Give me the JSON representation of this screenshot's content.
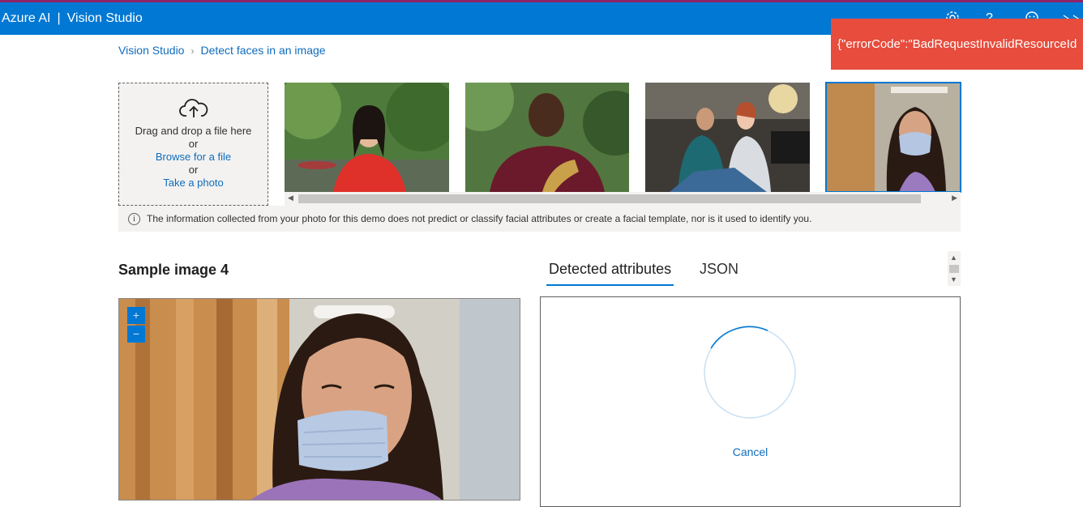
{
  "header": {
    "brand": "Azure AI",
    "separator": "|",
    "product": "Vision Studio",
    "icons": [
      "settings-icon",
      "help-icon",
      "feedback-icon",
      "account-icon"
    ]
  },
  "error_toast": {
    "text": "{\"errorCode\":\"BadRequestInvalidResourceId"
  },
  "breadcrumb": {
    "home": "Vision Studio",
    "current": "Detect faces in an image"
  },
  "upload": {
    "drag_text": "Drag and drop a file here",
    "or1": "or",
    "browse": "Browse for a file",
    "or2": "or",
    "take_photo": "Take a photo"
  },
  "info": {
    "text": "The information collected from your photo for this demo does not predict or classify facial attributes or create a facial template, nor is it used to identify you."
  },
  "sample": {
    "title": "Sample image 4"
  },
  "tabs": [
    {
      "label": "Detected attributes",
      "active": true
    },
    {
      "label": "JSON",
      "active": false
    }
  ],
  "zoom": {
    "in": "+",
    "out": "−"
  },
  "result": {
    "cancel": "Cancel"
  },
  "colors": {
    "accent": "#0078d4",
    "error": "#e74c3c",
    "top_stripe": "#8e2468"
  }
}
